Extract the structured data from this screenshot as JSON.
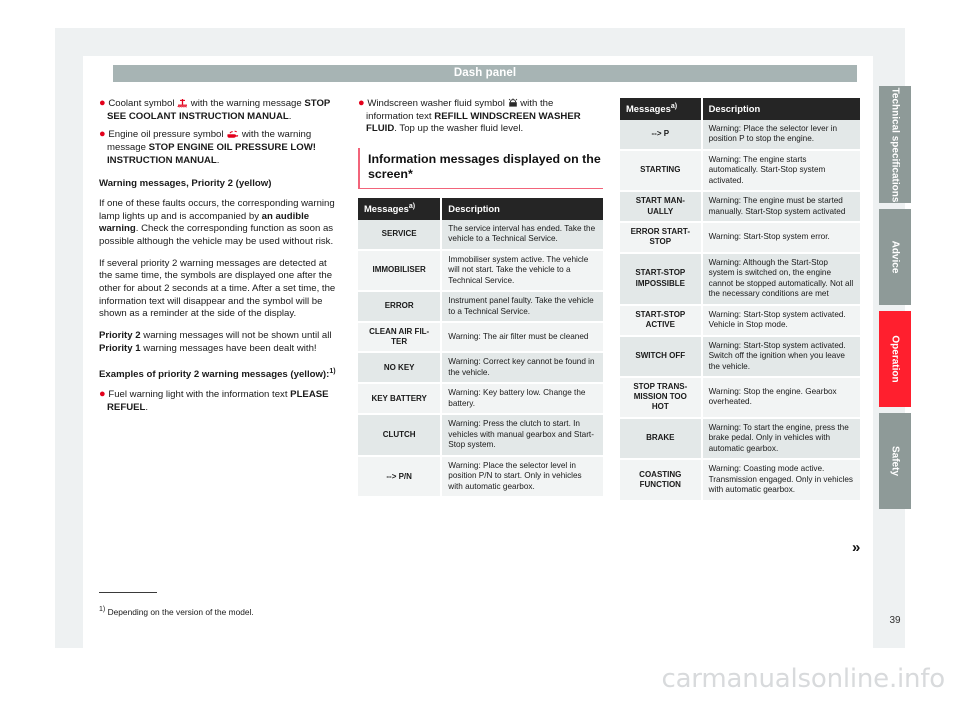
{
  "header": {
    "title": "Dash panel"
  },
  "left_column": {
    "bullets": [
      {
        "pre": "Coolant symbol ",
        "symbol": "coolant-temperature-icon",
        "mid": " with the warning message ",
        "bold": "STOP SEE COOLANT INSTRUCTION MANUAL",
        "post": "."
      },
      {
        "pre": "Engine oil pressure symbol ",
        "symbol": "oil-pressure-icon",
        "mid": " with the warning message ",
        "bold": "STOP ENGINE OIL PRESSURE LOW! INSTRUCTION MANUAL",
        "post": "."
      }
    ],
    "heading_priority2": "Warning messages, Priority 2 (yellow)",
    "para1_a": "If one of these faults occurs, the corresponding warning lamp lights up and is accompanied by ",
    "para1_bold": "an audible warning",
    "para1_b": ". Check the corresponding function as soon as possible although the vehicle may be used without risk.",
    "para2": "If several priority 2 warning messages are detected at the same time, the symbols are displayed one after the other for about 2 seconds at a time. After a set time, the information text will disappear and the symbol will be shown as a reminder at the side of the display.",
    "para3_bold1": "Priority 2",
    "para3_mid": " warning messages will not be shown until all ",
    "para3_bold2": "Priority 1",
    "para3_end": " warning messages have been dealt with!",
    "examples_heading": "Examples of priority 2 warning messages (yellow):",
    "examples_heading_sup": "1)",
    "example_bullet": {
      "pre": "Fuel warning light with the information text ",
      "bold": "PLEASE REFUEL",
      "post": "."
    }
  },
  "mid_column": {
    "bullet": {
      "pre": "Windscreen washer fluid symbol ",
      "symbol": "washer-fluid-icon",
      "mid": " with the information text ",
      "bold": "REFILL WINDSCREEN WASHER FLUID",
      "post": ". Top up the washer fluid level."
    },
    "section_heading": "Information messages displayed on the screen*",
    "table": {
      "headers": {
        "messages": "Messages",
        "messages_sup": "a)",
        "description": "Description"
      },
      "rows": [
        {
          "message": "SERVICE",
          "description": "The service interval has ended. Take the vehicle to a Technical Service."
        },
        {
          "message": "IMMOBILISER",
          "description": "Immobiliser system active. The vehicle will not start. Take the vehicle to a Technical Service."
        },
        {
          "message": "ERROR",
          "description": "Instrument panel faulty. Take the vehicle to a Technical Service."
        },
        {
          "message": "CLEAN AIR FIL-TER",
          "description": "Warning: The air filter must be cleaned"
        },
        {
          "message": "NO KEY",
          "description": "Warning: Correct key cannot be found in the vehicle."
        },
        {
          "message": "KEY BATTERY",
          "description": "Warning: Key battery low. Change the battery."
        },
        {
          "message": "CLUTCH",
          "description": "Warning: Press the clutch to start. In vehicles with manual gearbox and Start-Stop system."
        },
        {
          "message": "--> P/N",
          "description": "Warning: Place the selector level in position P/N to start. Only in vehicles with automatic gearbox."
        }
      ]
    }
  },
  "right_column": {
    "table": {
      "headers": {
        "messages": "Messages",
        "messages_sup": "a)",
        "description": "Description"
      },
      "rows": [
        {
          "message": "--> P",
          "description": "Warning: Place the selector lever in position P to stop the engine."
        },
        {
          "message": "STARTING",
          "description": "Warning: The engine starts automatically. Start-Stop system activated."
        },
        {
          "message": "START MAN-UALLY",
          "description": "Warning: The engine must be started manually. Start-Stop system activated"
        },
        {
          "message": "ERROR START-STOP",
          "description": "Warning: Start-Stop system error."
        },
        {
          "message": "START-STOP IMPOSSIBLE",
          "description": "Warning: Although the Start-Stop system is switched on, the engine cannot be stopped automatically. Not all the necessary conditions are met"
        },
        {
          "message": "START-STOP ACTIVE",
          "description": "Warning: Start-Stop system activated. Vehicle in Stop mode."
        },
        {
          "message": "SWITCH OFF",
          "description": "Warning: Start-Stop system activated. Switch off the ignition when you leave the vehicle."
        },
        {
          "message": "STOP TRANS-MISSION TOO HOT",
          "description": "Warning: Stop the engine. Gearbox overheated."
        },
        {
          "message": "BRAKE",
          "description": "Warning: To start the engine, press the brake pedal. Only in vehicles with automatic gearbox."
        },
        {
          "message": "COASTING FUNCTION",
          "description": "Warning: Coasting mode active. Transmission engaged. Only in vehicles with automatic gearbox."
        }
      ]
    }
  },
  "footnote": {
    "marker": "1)",
    "text": "Depending on the version of the model."
  },
  "continuation": {
    "glyph": "»"
  },
  "sidebar": {
    "tabs": [
      {
        "label": "Technical specifications",
        "active": false
      },
      {
        "label": "Advice",
        "active": false
      },
      {
        "label": "Operation",
        "active": true
      },
      {
        "label": "Safety",
        "active": false
      }
    ],
    "page_number": "39"
  },
  "watermark": {
    "text": "carmanualsonline.info"
  },
  "colors": {
    "accent_red": "#e3001b",
    "tab_active": "#ff1f2e",
    "tab_inactive": "#8e9a98",
    "header_bar": "#a7b4b4",
    "table_header": "#252525",
    "row_odd": "#e3e8e8",
    "row_even": "#f2f4f4",
    "rule_pink": "#f2647a"
  }
}
